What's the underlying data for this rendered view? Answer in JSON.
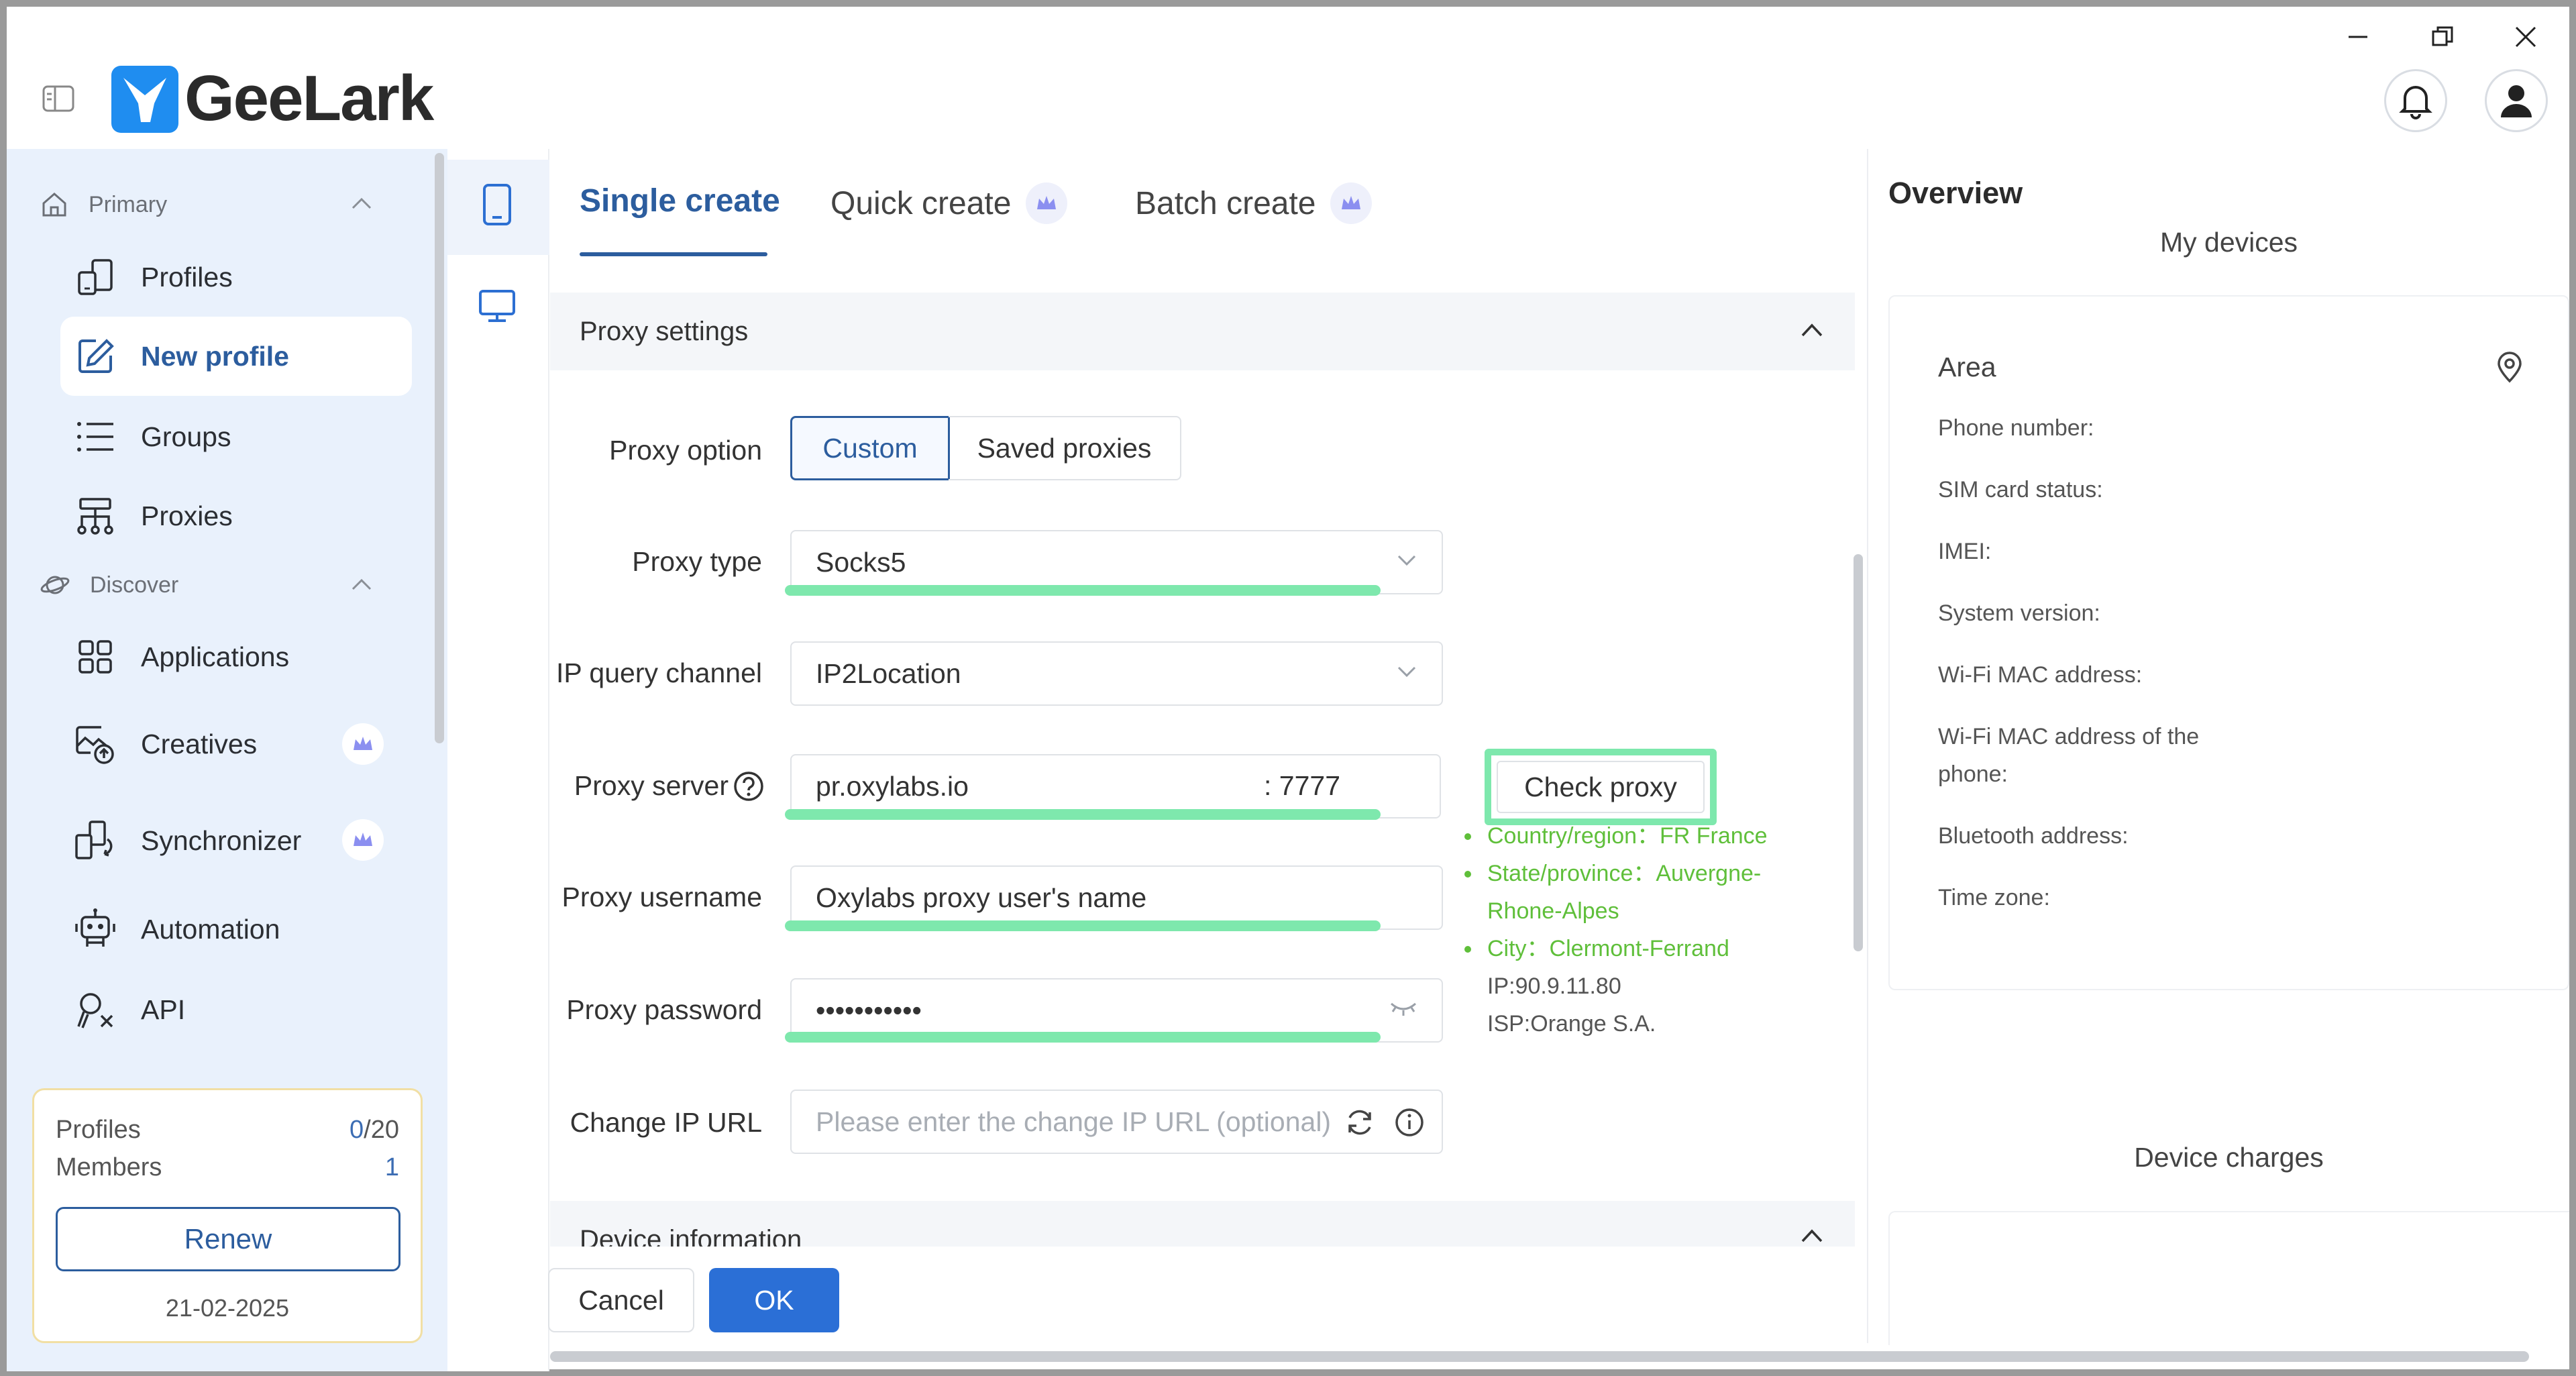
{
  "app": {
    "name": "GeeLark"
  },
  "sidebar": {
    "primary_label": "Primary",
    "discover_label": "Discover",
    "items": [
      {
        "label": "Profiles"
      },
      {
        "label": "New profile"
      },
      {
        "label": "Groups"
      },
      {
        "label": "Proxies"
      },
      {
        "label": "Applications"
      },
      {
        "label": "Creatives"
      },
      {
        "label": "Synchronizer"
      },
      {
        "label": "Automation"
      },
      {
        "label": "API"
      }
    ],
    "quota": {
      "profiles_label": "Profiles",
      "profiles_used": "0",
      "profiles_total": "/20",
      "members_label": "Members",
      "members_count": "1",
      "renew_label": "Renew",
      "date": "21-02-2025"
    }
  },
  "tabs": [
    {
      "label": "Single create"
    },
    {
      "label": "Quick create"
    },
    {
      "label": "Batch create"
    }
  ],
  "proxy_settings": {
    "title": "Proxy settings",
    "proxy_option_label": "Proxy option",
    "options": [
      "Custom",
      "Saved proxies"
    ],
    "proxy_type_label": "Proxy type",
    "proxy_type_value": "Socks5",
    "ip_query_label": "IP query channel",
    "ip_query_value": "IP2Location",
    "server_label": "Proxy server",
    "server_host": "pr.oxylabs.io",
    "server_port": ": 7777",
    "check_label": "Check proxy",
    "username_label": "Proxy username",
    "username_value": "Oxylabs proxy user's name",
    "password_label": "Proxy password",
    "password_value": "•••••••••••",
    "change_ip_label": "Change IP URL",
    "change_ip_placeholder": "Please enter the change IP URL (optional)",
    "result": {
      "country": "Country/region：FR France",
      "state_line1": "State/province：Auvergne-",
      "state_line2": "Rhone-Alpes",
      "city": "City：Clermont-Ferrand",
      "ip": "IP:90.9.11.80",
      "isp": "ISP:Orange S.A."
    }
  },
  "device_info": {
    "title": "Device information"
  },
  "footer": {
    "cancel_label": "Cancel",
    "ok_label": "OK"
  },
  "overview": {
    "title": "Overview",
    "my_devices": "My devices",
    "area_label": "Area",
    "fields": [
      "Phone number:",
      "SIM card status:",
      "IMEI:",
      "System version:",
      "Wi-Fi MAC address:",
      "Wi-Fi MAC address of the",
      "phone:",
      "Bluetooth address:",
      "Time zone:"
    ],
    "device_charges": "Device charges"
  },
  "colors": {
    "accent": "#2c5d9e",
    "ok_button": "#2b6fd6",
    "highlight": "#7ee8ad",
    "success_text": "#5fbf3a",
    "sidebar_bg": "#e9f1fc"
  }
}
